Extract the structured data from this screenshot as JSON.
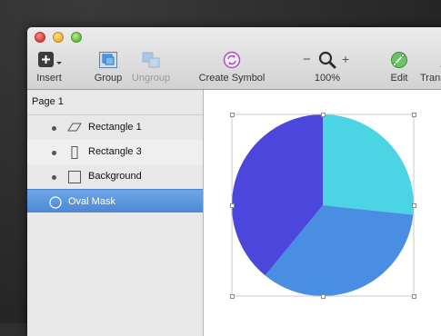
{
  "toolbar": {
    "insert": "Insert",
    "group": "Group",
    "ungroup": "Ungroup",
    "create_symbol": "Create Symbol",
    "zoom_minus": "−",
    "zoom_plus": "+",
    "zoom": "100%",
    "edit": "Edit",
    "transform": "Transform"
  },
  "sidebar": {
    "page": "Page 1",
    "layers": [
      {
        "name": "Rectangle 1"
      },
      {
        "name": "Rectangle 3"
      },
      {
        "name": "Background"
      },
      {
        "name": "Oval Mask"
      }
    ]
  },
  "colors": {
    "accent_blue": "#4c8fd9",
    "pie_cyan": "#4ad4e4",
    "pie_blue": "#4a8ee3",
    "pie_indigo": "#4b47dd",
    "selection": "#5a93dc"
  },
  "icons": [
    "insert-plus-icon",
    "group-icon",
    "ungroup-icon",
    "create-symbol-icon",
    "zoom-magnifier-icon",
    "edit-icon",
    "transform-icon",
    "triangle-shape-icon",
    "rectangle-shape-icon",
    "oval-shape-icon"
  ]
}
